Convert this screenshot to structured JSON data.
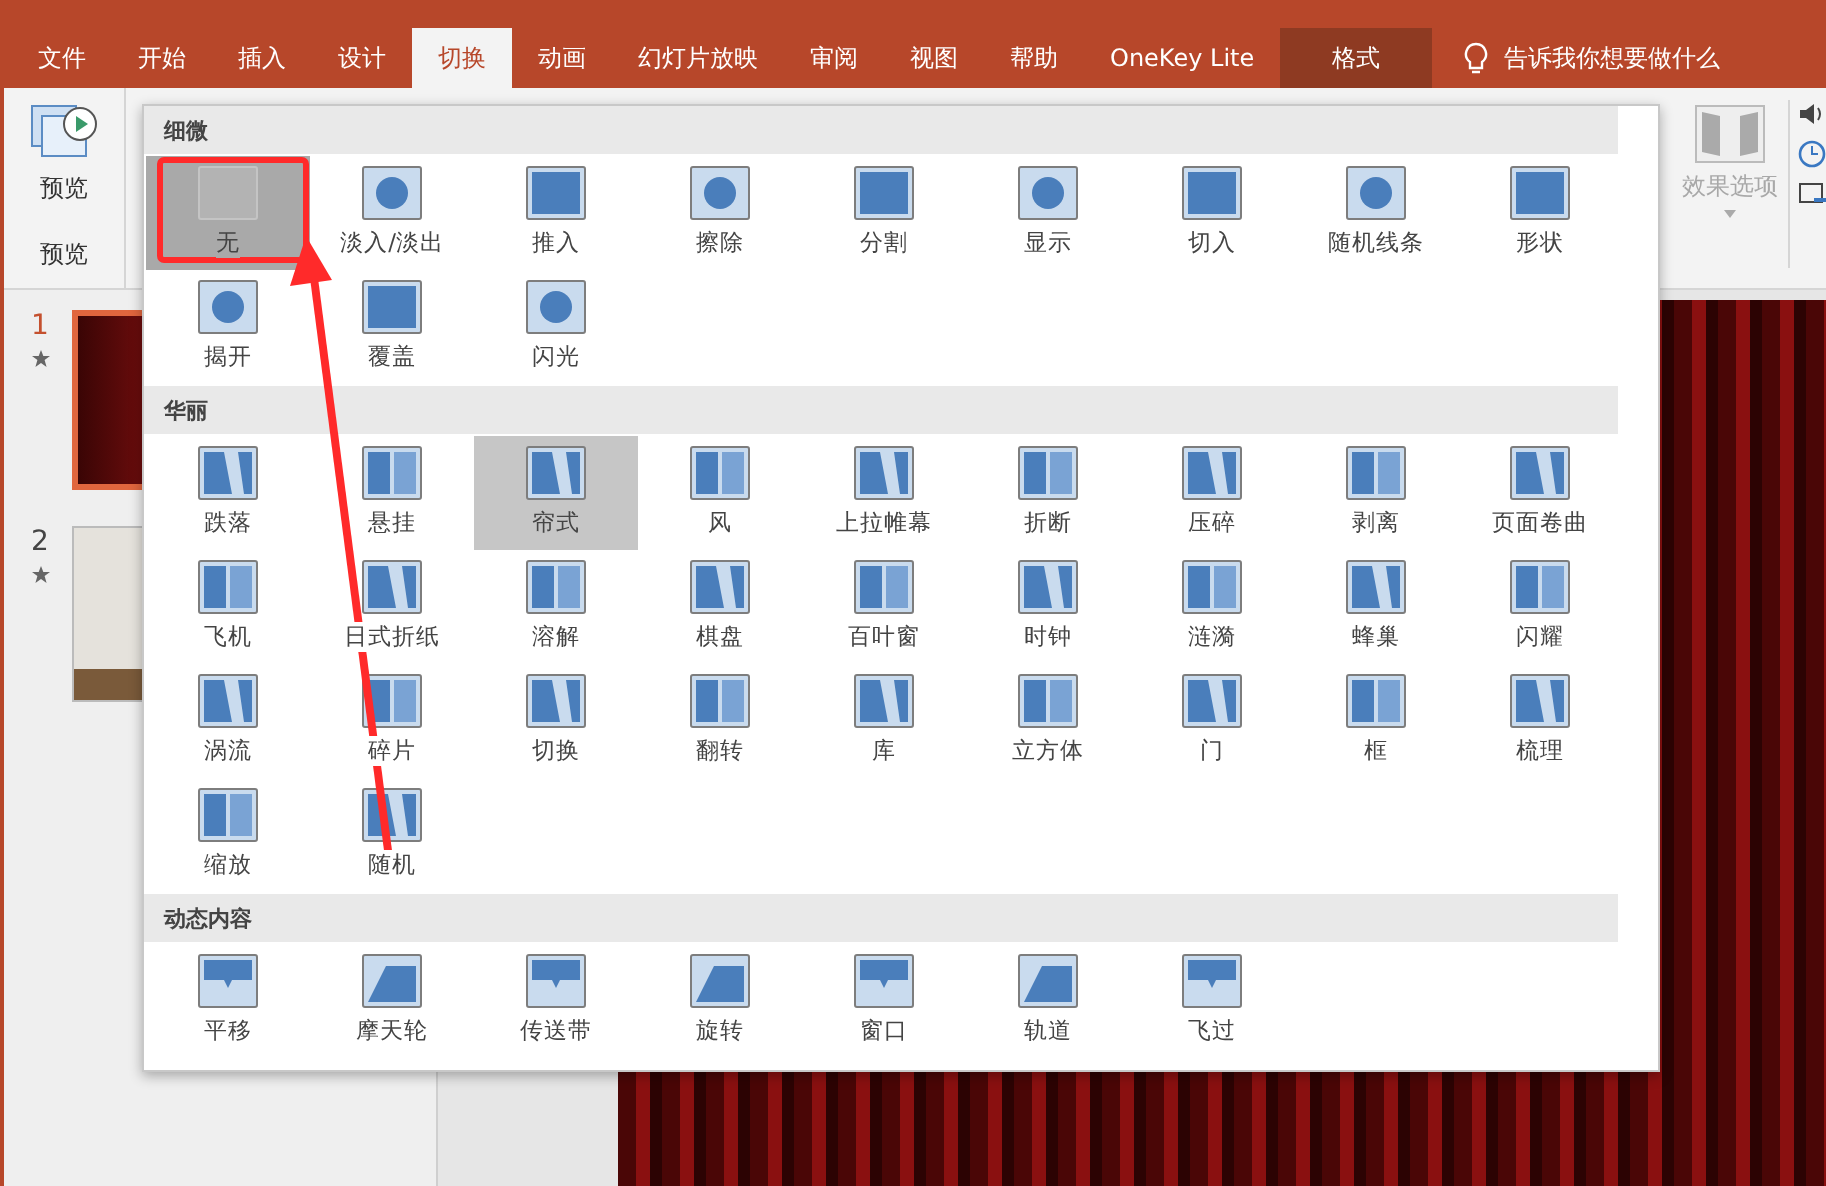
{
  "ribbon_tabs": [
    {
      "label": "文件",
      "selected": false,
      "kind": "normal"
    },
    {
      "label": "开始",
      "selected": false,
      "kind": "normal"
    },
    {
      "label": "插入",
      "selected": false,
      "kind": "normal"
    },
    {
      "label": "设计",
      "selected": false,
      "kind": "normal"
    },
    {
      "label": "切换",
      "selected": true,
      "kind": "normal"
    },
    {
      "label": "动画",
      "selected": false,
      "kind": "normal"
    },
    {
      "label": "幻灯片放映",
      "selected": false,
      "kind": "normal"
    },
    {
      "label": "审阅",
      "selected": false,
      "kind": "normal"
    },
    {
      "label": "视图",
      "selected": false,
      "kind": "normal"
    },
    {
      "label": "帮助",
      "selected": false,
      "kind": "normal"
    },
    {
      "label": "OneKey Lite",
      "selected": false,
      "kind": "normal"
    },
    {
      "label": "格式",
      "selected": false,
      "kind": "contextual"
    }
  ],
  "tell_me": {
    "placeholder": "告诉我你想要做什么"
  },
  "ribbon": {
    "preview_button": "预览",
    "group_label": "预览",
    "effect_options": {
      "label": "效果选项",
      "disabled": true
    }
  },
  "slides": [
    {
      "number": "1",
      "selected": true,
      "kind": "curtain"
    },
    {
      "number": "2",
      "selected": false,
      "kind": "wall"
    }
  ],
  "gallery": {
    "sections": [
      {
        "title": "细微",
        "items": [
          {
            "label": "无",
            "selected": true,
            "highlighted": false
          },
          {
            "label": "淡入/淡出",
            "selected": false,
            "highlighted": false
          },
          {
            "label": "推入",
            "selected": false,
            "highlighted": false
          },
          {
            "label": "擦除",
            "selected": false,
            "highlighted": false
          },
          {
            "label": "分割",
            "selected": false,
            "highlighted": false
          },
          {
            "label": "显示",
            "selected": false,
            "highlighted": false
          },
          {
            "label": "切入",
            "selected": false,
            "highlighted": false
          },
          {
            "label": "随机线条",
            "selected": false,
            "highlighted": false
          },
          {
            "label": "形状",
            "selected": false,
            "highlighted": false
          },
          {
            "label": "揭开",
            "selected": false,
            "highlighted": false
          },
          {
            "label": "覆盖",
            "selected": false,
            "highlighted": false
          },
          {
            "label": "闪光",
            "selected": false,
            "highlighted": false
          }
        ]
      },
      {
        "title": "华丽",
        "items": [
          {
            "label": "跌落",
            "selected": false,
            "highlighted": false
          },
          {
            "label": "悬挂",
            "selected": false,
            "highlighted": false
          },
          {
            "label": "帘式",
            "selected": false,
            "highlighted": true
          },
          {
            "label": "风",
            "selected": false,
            "highlighted": false
          },
          {
            "label": "上拉帷幕",
            "selected": false,
            "highlighted": false
          },
          {
            "label": "折断",
            "selected": false,
            "highlighted": false
          },
          {
            "label": "压碎",
            "selected": false,
            "highlighted": false
          },
          {
            "label": "剥离",
            "selected": false,
            "highlighted": false
          },
          {
            "label": "页面卷曲",
            "selected": false,
            "highlighted": false
          },
          {
            "label": "飞机",
            "selected": false,
            "highlighted": false
          },
          {
            "label": "日式折纸",
            "selected": false,
            "highlighted": false
          },
          {
            "label": "溶解",
            "selected": false,
            "highlighted": false
          },
          {
            "label": "棋盘",
            "selected": false,
            "highlighted": false
          },
          {
            "label": "百叶窗",
            "selected": false,
            "highlighted": false
          },
          {
            "label": "时钟",
            "selected": false,
            "highlighted": false
          },
          {
            "label": "涟漪",
            "selected": false,
            "highlighted": false
          },
          {
            "label": "蜂巢",
            "selected": false,
            "highlighted": false
          },
          {
            "label": "闪耀",
            "selected": false,
            "highlighted": false
          },
          {
            "label": "涡流",
            "selected": false,
            "highlighted": false
          },
          {
            "label": "碎片",
            "selected": false,
            "highlighted": false
          },
          {
            "label": "切换",
            "selected": false,
            "highlighted": false
          },
          {
            "label": "翻转",
            "selected": false,
            "highlighted": false
          },
          {
            "label": "库",
            "selected": false,
            "highlighted": false
          },
          {
            "label": "立方体",
            "selected": false,
            "highlighted": false
          },
          {
            "label": "门",
            "selected": false,
            "highlighted": false
          },
          {
            "label": "框",
            "selected": false,
            "highlighted": false
          },
          {
            "label": "梳理",
            "selected": false,
            "highlighted": false
          },
          {
            "label": "缩放",
            "selected": false,
            "highlighted": false
          },
          {
            "label": "随机",
            "selected": false,
            "highlighted": false
          }
        ]
      },
      {
        "title": "动态内容",
        "items": [
          {
            "label": "平移",
            "selected": false,
            "highlighted": false
          },
          {
            "label": "摩天轮",
            "selected": false,
            "highlighted": false
          },
          {
            "label": "传送带",
            "selected": false,
            "highlighted": false
          },
          {
            "label": "旋转",
            "selected": false,
            "highlighted": false
          },
          {
            "label": "窗口",
            "selected": false,
            "highlighted": false
          },
          {
            "label": "轨道",
            "selected": false,
            "highlighted": false
          },
          {
            "label": "飞过",
            "selected": false,
            "highlighted": false
          }
        ]
      }
    ]
  }
}
